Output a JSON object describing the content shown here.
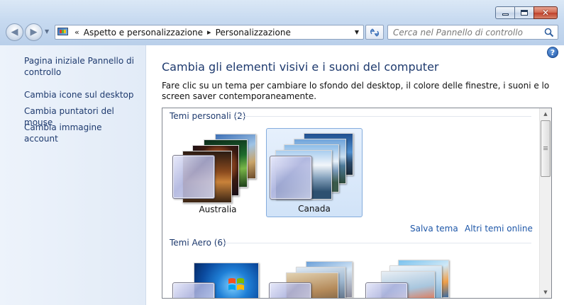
{
  "window": {
    "minimize": "",
    "maximize": "",
    "close": "✕"
  },
  "address_bar": {
    "overflow": "«",
    "crumbs": [
      "Aspetto e personalizzazione",
      "Personalizzazione"
    ],
    "separator": "▸"
  },
  "search": {
    "placeholder": "Cerca nel Pannello di controllo"
  },
  "left_pane": {
    "home_link": "Pagina iniziale Pannello di controllo",
    "links": [
      "Cambia icone sul desktop",
      "Cambia puntatori del mouse",
      "Cambia immagine account"
    ]
  },
  "main": {
    "title": "Cambia gli elementi visivi e i suoni del computer",
    "description": "Fare clic su un tema per cambiare lo sfondo del desktop, il colore delle finestre, i suoni e lo screen saver contemporaneamente.",
    "help": "?"
  },
  "themes": {
    "personal_group": "Temi personali (2)",
    "personal": [
      {
        "name": "Australia",
        "selected": false
      },
      {
        "name": "Canada",
        "selected": true
      }
    ],
    "save_link": "Salva tema",
    "online_link": "Altri temi online",
    "aero_group": "Temi Aero (6)"
  },
  "colors": {
    "link": "#1e57a8",
    "heading": "#1e3a6e",
    "selection": "#d1e3f8"
  },
  "icons": {
    "back": "back-arrow-icon",
    "forward": "forward-arrow-icon",
    "refresh": "refresh-icon",
    "search": "magnifier-icon",
    "help": "help-icon",
    "control_panel": "control-panel-icon"
  }
}
